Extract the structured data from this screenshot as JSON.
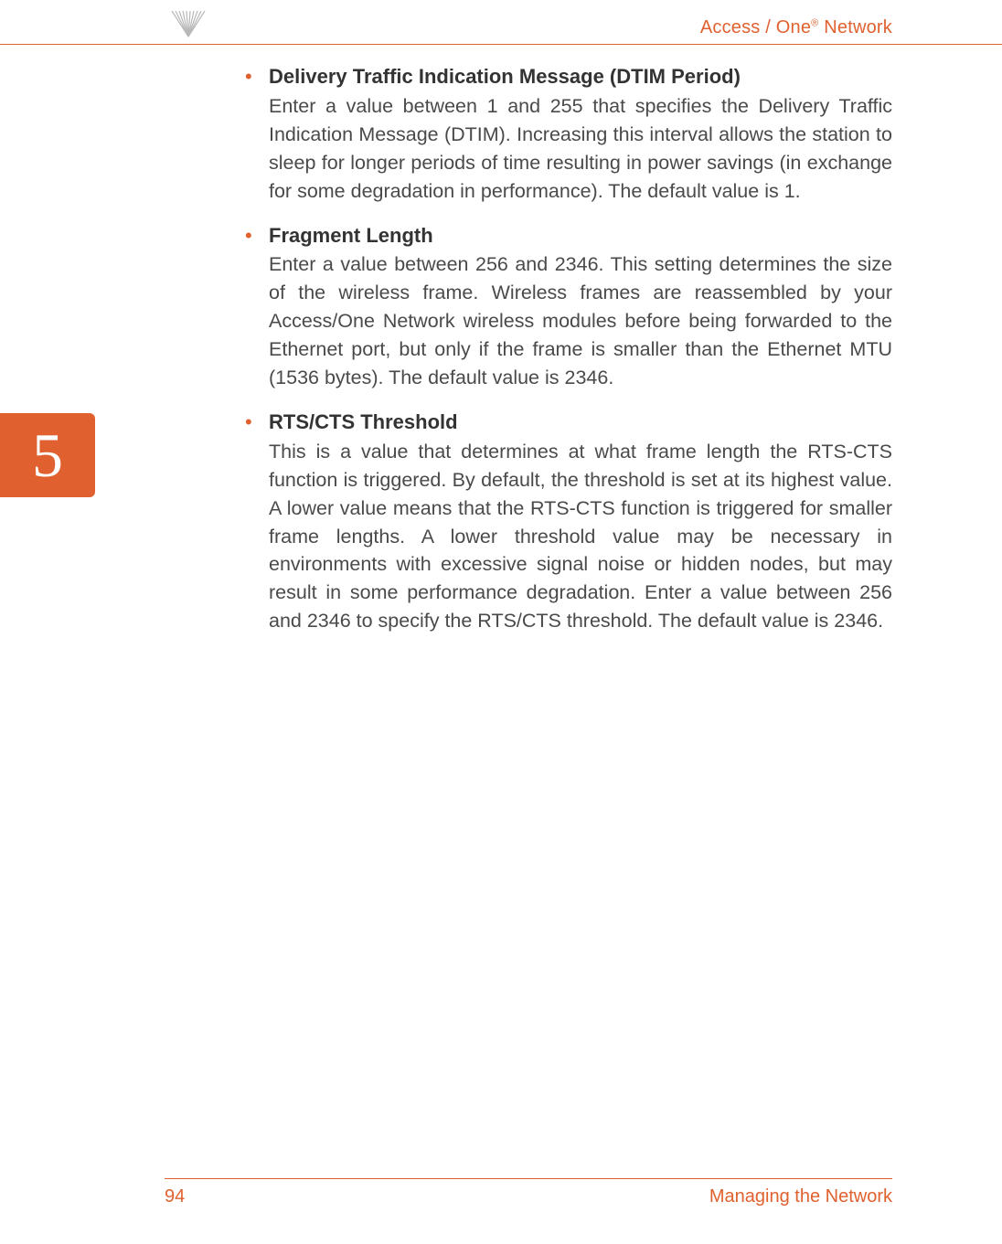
{
  "header": {
    "title_prefix": "Access / One",
    "title_suffix": " Network",
    "reg_mark": "®"
  },
  "chapter": {
    "number": "5"
  },
  "items": [
    {
      "title": "Delivery Traffic Indication Message (DTIM Period)",
      "body": "Enter a value between 1 and 255 that specifies the Delivery Traffic Indication Message (DTIM). Increasing this interval allows the station to sleep for longer periods of time resulting in power savings (in exchange for some degradation in performance). The default value is 1."
    },
    {
      "title": "Fragment Length",
      "body": "Enter a value between 256 and 2346. This setting determines the size of the wireless frame. Wireless frames are reassembled by your Access/One Network wireless modules before being forwarded to the Ethernet port, but only if the frame is smaller than the Ethernet MTU (1536 bytes). The default value is 2346."
    },
    {
      "title": "RTS/CTS Threshold",
      "body": "This is a value that determines at what frame length the RTS-CTS function is triggered. By default, the threshold is set at its highest value. A lower value means that the RTS-CTS function is triggered for smaller frame lengths. A lower threshold value may be necessary in environments with excessive signal noise or hidden nodes, but may result in some performance degradation. Enter a value between 256 and 2346 to specify the RTS/CTS threshold. The default value is 2346."
    }
  ],
  "footer": {
    "page_number": "94",
    "section_title": "Managing the Network"
  }
}
